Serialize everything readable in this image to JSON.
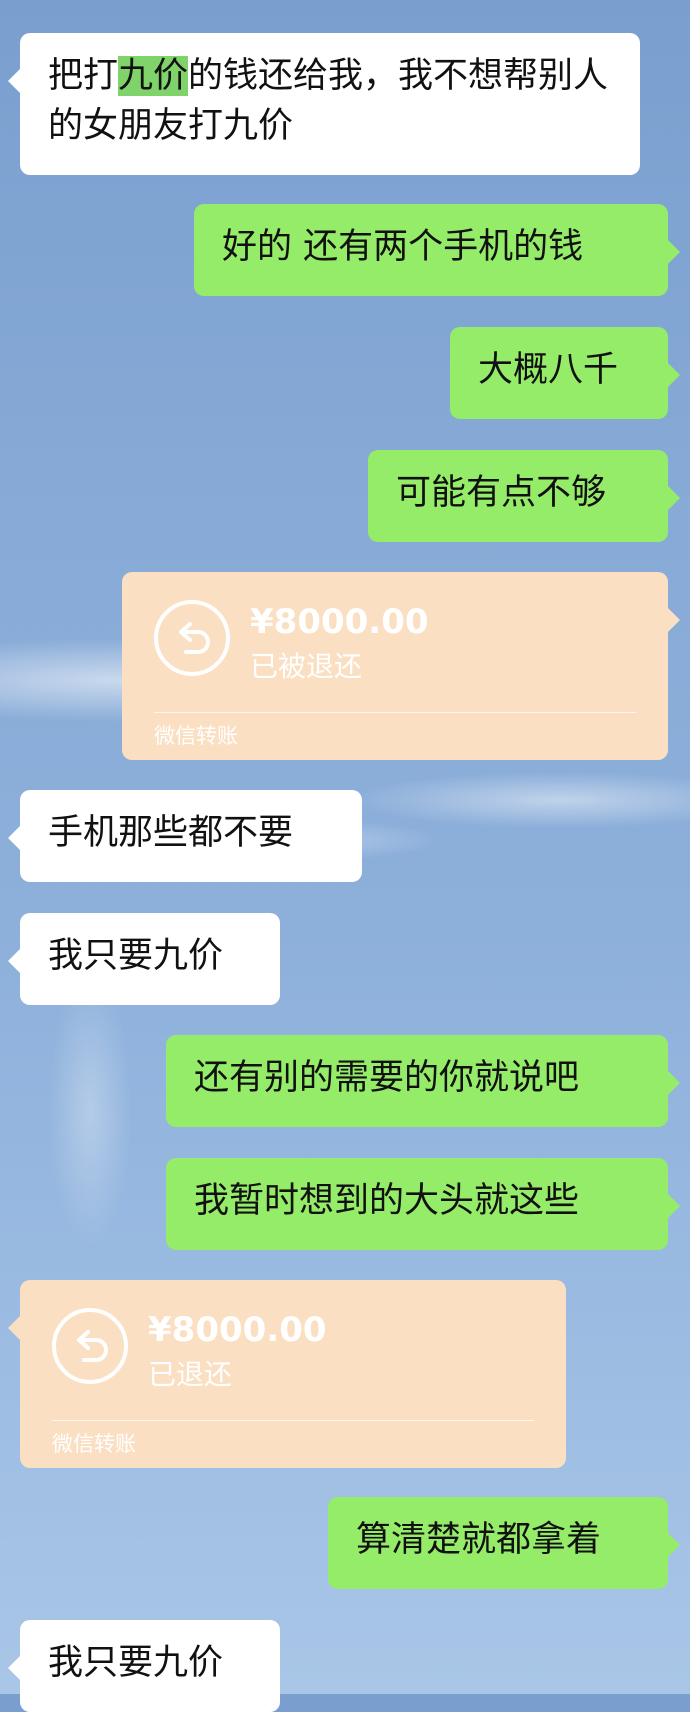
{
  "messages": [
    {
      "side": "left",
      "pre": "把打",
      "highlight": "九价",
      "post": "的钱还给我，我不想帮别人的女朋友打九价"
    },
    {
      "side": "right",
      "text": "好的 还有两个手机的钱"
    },
    {
      "side": "right",
      "text": "大概八千"
    },
    {
      "side": "right",
      "text": "可能有点不够"
    },
    {
      "side": "right",
      "type": "transfer",
      "amount": "¥8000.00",
      "status": "已被退还",
      "footer": "微信转账"
    },
    {
      "side": "left",
      "text": "手机那些都不要"
    },
    {
      "side": "left",
      "text": "我只要九价"
    },
    {
      "side": "right",
      "text": "还有别的需要的你就说吧"
    },
    {
      "side": "right",
      "text": "我暂时想到的大头就这些"
    },
    {
      "side": "left",
      "type": "transfer",
      "amount": "¥8000.00",
      "status": "已退还",
      "footer": "微信转账"
    },
    {
      "side": "right",
      "text": "算清楚就都拿着"
    },
    {
      "side": "left",
      "text": "我只要九价"
    }
  ],
  "icons": {
    "transfer_status": "refund-arrow-icon"
  },
  "colors": {
    "sent_bubble": "#95ec69",
    "received_bubble": "#ffffff",
    "transfer_card": "#fbdfc2"
  }
}
